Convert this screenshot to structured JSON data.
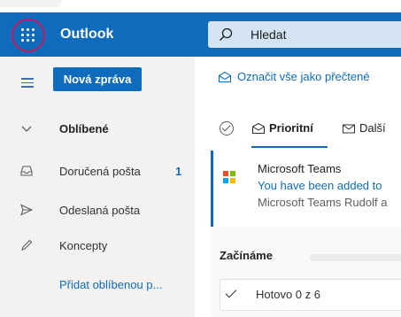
{
  "header": {
    "app_name": "Outlook",
    "search_placeholder": "Hledat",
    "brand_color": "#0f6cbd"
  },
  "nav": {
    "new_message_label": "Nová zpráva",
    "favorites_label": "Oblíbené",
    "items": [
      {
        "label": "Doručená pošta",
        "count": "1",
        "icon": "inbox-icon"
      },
      {
        "label": "Odeslaná pošta",
        "icon": "send-icon"
      },
      {
        "label": "Koncepty",
        "icon": "pencil-icon"
      }
    ],
    "add_favorite_label": "Přidat oblíbenou p..."
  },
  "command_bar": {
    "mark_all_read_label": "Označit vše jako přečtené"
  },
  "tabs": {
    "focused_label": "Prioritní",
    "other_label": "Další"
  },
  "message": {
    "sender": "Microsoft Teams",
    "subject": "You have been added to",
    "preview": "Microsoft Teams Rudolf a"
  },
  "getting_started": {
    "title": "Začínáme",
    "status": "Hotovo 0 z 6",
    "progress": 0
  }
}
